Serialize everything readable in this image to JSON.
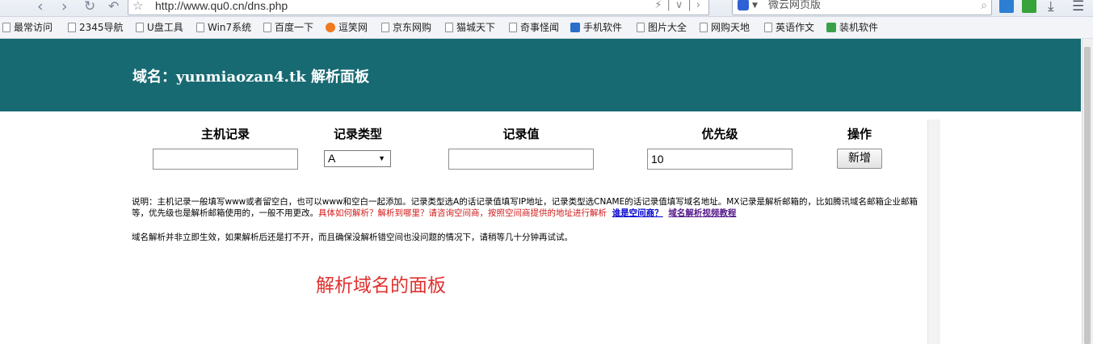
{
  "browser": {
    "url": "http://www.qu0.cn/dns.php",
    "search_placeholder": "微云网页版"
  },
  "bookmarks": [
    {
      "label": "最常访问"
    },
    {
      "label": "2345导航"
    },
    {
      "label": "U盘工具"
    },
    {
      "label": "Win7系统"
    },
    {
      "label": "百度一下"
    },
    {
      "label": "逗笑网"
    },
    {
      "label": "京东网购"
    },
    {
      "label": "猫城天下"
    },
    {
      "label": "奇事怪闻"
    },
    {
      "label": "手机软件"
    },
    {
      "label": "图片大全"
    },
    {
      "label": "网购天地"
    },
    {
      "label": "英语作文"
    },
    {
      "label": "装机软件"
    }
  ],
  "page": {
    "title": "域名：yunmiaozan4.tk 解析面板",
    "columns": {
      "host": "主机记录",
      "type": "记录类型",
      "value": "记录值",
      "priority": "优先级",
      "action": "操作"
    },
    "form": {
      "host_value": "",
      "type_selected": "A",
      "record_value": "",
      "priority_value": "10",
      "add_label": "新增"
    },
    "help": {
      "text": "说明：主机记录一般填写www或者留空白，也可以www和空白一起添加。记录类型选A的话记录值填写IP地址，记录类型选CNAME的话记录值填写域名地址。MX记录是解析邮箱的，比如腾讯域名邮箱企业邮箱等，优先级也是解析邮箱使用的，一般不用更改。",
      "red_text": "具体如何解析？解析到哪里？请咨询空间商，按照空间商提供的地址进行解析",
      "link1": "谁是空间商？",
      "link2": "域名解析视频教程"
    },
    "notice": "域名解析并非立即生效，如果解析后还是打不开，而且确保没解析错空间也没问题的情况下，请稍等几十分钟再试试。",
    "annotation": "解析域名的面板"
  },
  "colors": {
    "banner": "#186a72",
    "annotation": "#e0312e",
    "help_red": "#d11a1a"
  }
}
